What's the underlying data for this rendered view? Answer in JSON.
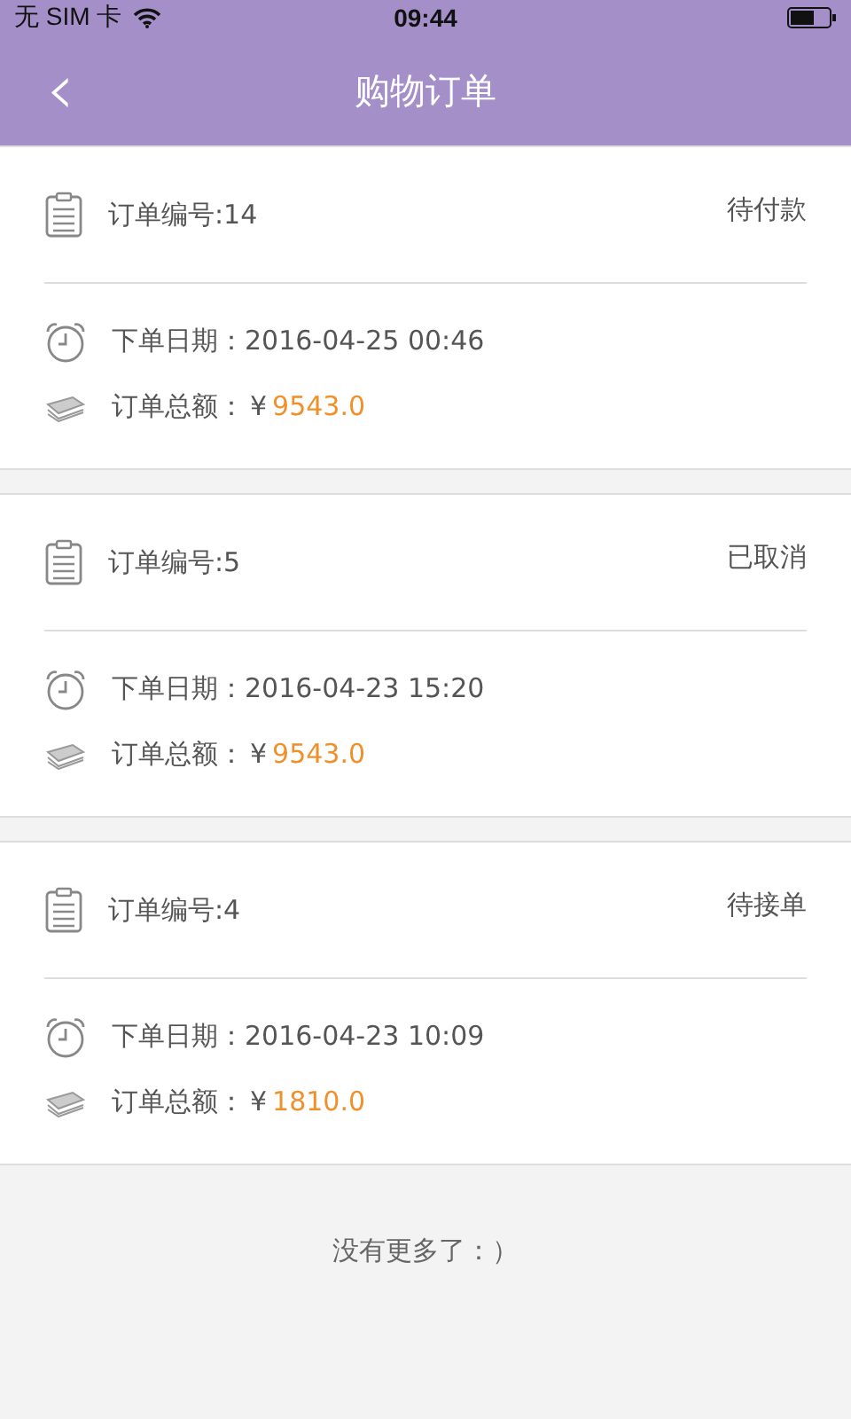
{
  "status_bar": {
    "carrier": "无 SIM 卡",
    "time": "09:44"
  },
  "nav_bar": {
    "back": "‹",
    "title": "购物订单"
  },
  "orders": [
    {
      "number": "订单编号:14",
      "status": "待付款",
      "date": "下单日期：2016-04-25 00:46",
      "amount_label": "订单总额：",
      "currency": "¥",
      "amount": "9543.0"
    },
    {
      "number": "订单编号:5",
      "status": "已取消",
      "date": "下单日期：2016-04-23 15:20",
      "amount_label": "订单总额：",
      "currency": "¥",
      "amount": "9543.0"
    },
    {
      "number": "订单编号:4",
      "status": "待接单",
      "date": "下单日期：2016-04-23 10:09",
      "amount_label": "订单总额：",
      "currency": "¥",
      "amount": "1810.0"
    }
  ],
  "footer": "没有更多了：）"
}
